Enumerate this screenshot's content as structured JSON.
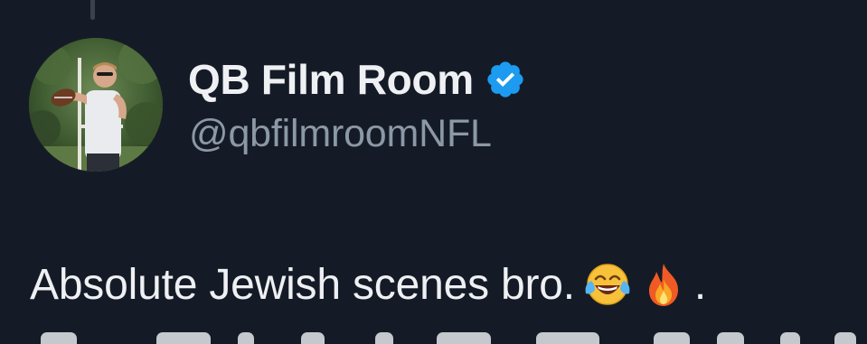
{
  "tweet": {
    "author": {
      "display_name": "QB Film Room",
      "handle": "@qbfilmroomNFL",
      "verified": true,
      "verified_icon": "verified-badge-icon",
      "avatar_icon": "profile-photo"
    },
    "text": "Absolute Jewish scenes bro.",
    "emojis": [
      "face-with-tears-of-joy-icon",
      "fire-icon"
    ],
    "trailing_text": "."
  },
  "colors": {
    "background": "#151b26",
    "primary_text": "#eef0f3",
    "secondary_text": "#8b98a6",
    "verified_blue": "#1d9bf0"
  }
}
